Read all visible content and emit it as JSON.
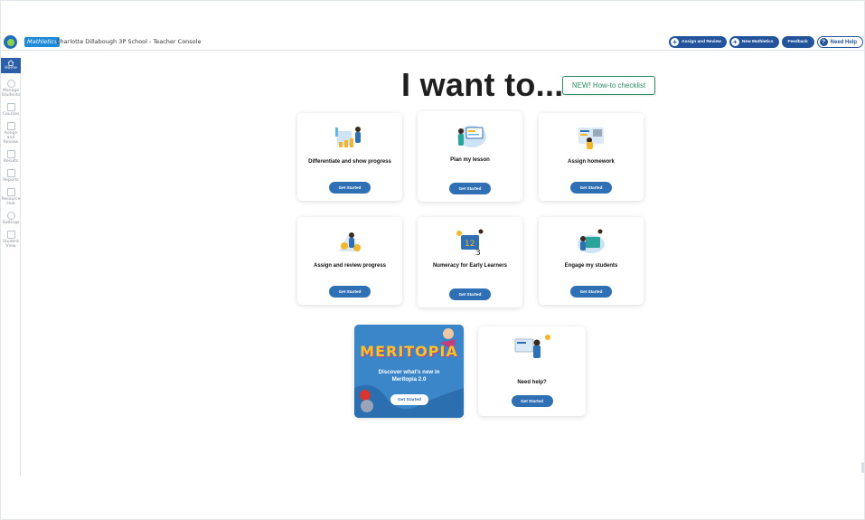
{
  "header": {
    "brand": "Mathletics",
    "school_title": "Charlotte Dillabough 3P School - Teacher Console",
    "buttons": {
      "assign_review": "Assign and Review",
      "new_mathletics": "New Mathletics",
      "feedback": "Feedback",
      "need_help": "Need Help"
    }
  },
  "sidebar": {
    "items": [
      {
        "label": "Home",
        "icon": "home-icon"
      },
      {
        "label": "Manage Students",
        "icon": "students-icon"
      },
      {
        "label": "Courses",
        "icon": "courses-icon"
      },
      {
        "label": "Assign and Review",
        "icon": "assign-icon"
      },
      {
        "label": "Results",
        "icon": "results-icon"
      },
      {
        "label": "Reports",
        "icon": "reports-icon"
      },
      {
        "label": "Resource Hub",
        "icon": "resource-icon"
      },
      {
        "label": "Settings",
        "icon": "settings-icon"
      },
      {
        "label": "Student View",
        "icon": "student-view-icon"
      }
    ]
  },
  "main": {
    "heading": "I want to...",
    "checklist_label": "NEW! How-to checklist",
    "get_started": "Get Started",
    "cards": [
      {
        "title": "Differentiate and show progress",
        "icon": "differentiate-illustration"
      },
      {
        "title": "Plan my lesson",
        "icon": "plan-lesson-illustration"
      },
      {
        "title": "Assign homework",
        "icon": "homework-illustration"
      },
      {
        "title": "Assign and review progress",
        "icon": "review-progress-illustration"
      },
      {
        "title": "Numeracy for Early Learners",
        "icon": "numeracy-illustration"
      },
      {
        "title": "Engage my students",
        "icon": "engage-illustration"
      }
    ],
    "meritopia": {
      "title": "MERITOPIA",
      "subtitle": "Discover what's new in Meritopia 2.0",
      "button": "Get Started"
    },
    "help_card": {
      "title": "Need help?",
      "button": "Get Started"
    }
  },
  "colors": {
    "accent": "#2f6fb3",
    "header_button": "#23549b",
    "checklist": "#2e8b63",
    "brand": "#1f8ad8"
  }
}
